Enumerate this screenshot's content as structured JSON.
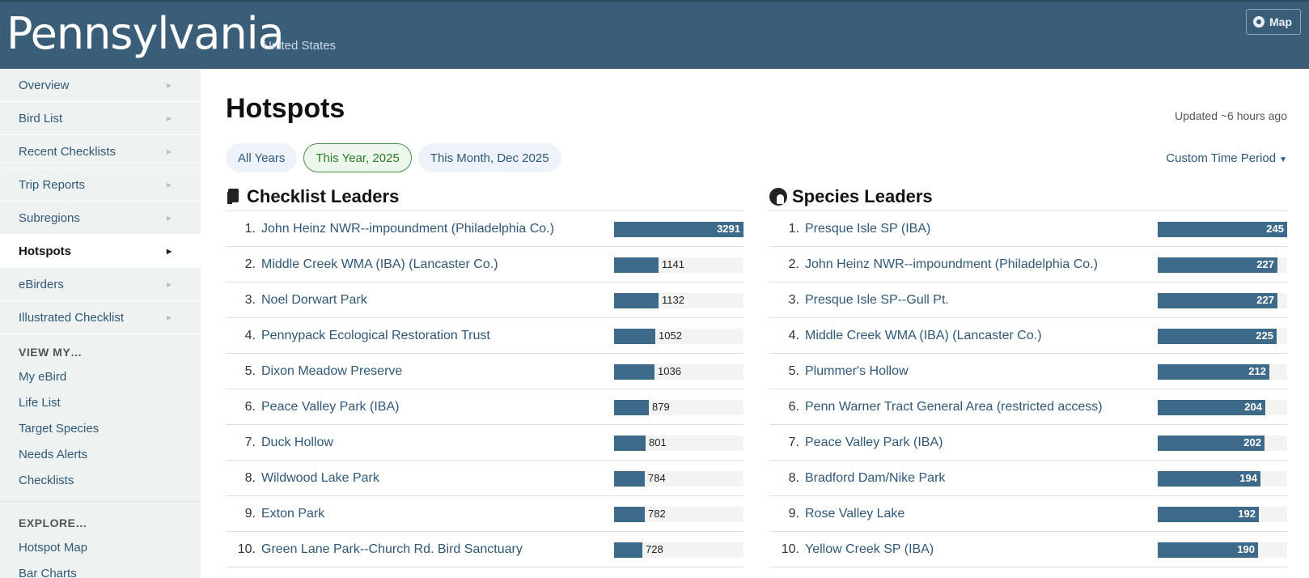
{
  "header": {
    "title": "Pennsylvania",
    "subtitle": "United States",
    "map_label": "Map"
  },
  "sidebar": {
    "items": [
      {
        "label": "Overview",
        "active": false
      },
      {
        "label": "Bird List",
        "active": false
      },
      {
        "label": "Recent Checklists",
        "active": false
      },
      {
        "label": "Trip Reports",
        "active": false
      },
      {
        "label": "Subregions",
        "active": false
      },
      {
        "label": "Hotspots",
        "active": true
      },
      {
        "label": "eBirders",
        "active": false
      },
      {
        "label": "Illustrated Checklist",
        "active": false
      }
    ],
    "view_my_title": "VIEW MY…",
    "view_my": [
      "My eBird",
      "Life List",
      "Target Species",
      "Needs Alerts",
      "Checklists"
    ],
    "explore_title": "EXPLORE…",
    "explore": [
      "Hotspot Map",
      "Bar Charts"
    ]
  },
  "main": {
    "title": "Hotspots",
    "updated": "Updated ~6 hours ago",
    "pills": [
      {
        "label": "All Years",
        "selected": false
      },
      {
        "label": "This Year, 2025",
        "selected": true
      },
      {
        "label": "This Month, Dec 2025",
        "selected": false
      }
    ],
    "custom_period": "Custom Time Period"
  },
  "checklist_leaders": {
    "title": "Checklist Leaders",
    "max": 3291,
    "rows": [
      {
        "rank": "1.",
        "name": "John Heinz NWR--impoundment (Philadelphia Co.)",
        "value": 3291
      },
      {
        "rank": "2.",
        "name": "Middle Creek WMA (IBA) (Lancaster Co.)",
        "value": 1141
      },
      {
        "rank": "3.",
        "name": "Noel Dorwart Park",
        "value": 1132
      },
      {
        "rank": "4.",
        "name": "Pennypack Ecological Restoration Trust",
        "value": 1052
      },
      {
        "rank": "5.",
        "name": "Dixon Meadow Preserve",
        "value": 1036
      },
      {
        "rank": "6.",
        "name": "Peace Valley Park (IBA)",
        "value": 879
      },
      {
        "rank": "7.",
        "name": "Duck Hollow",
        "value": 801
      },
      {
        "rank": "8.",
        "name": "Wildwood Lake Park",
        "value": 784
      },
      {
        "rank": "9.",
        "name": "Exton Park",
        "value": 782
      },
      {
        "rank": "10.",
        "name": "Green Lane Park--Church Rd. Bird Sanctuary",
        "value": 728
      }
    ]
  },
  "species_leaders": {
    "title": "Species Leaders",
    "max": 245,
    "rows": [
      {
        "rank": "1.",
        "name": "Presque Isle SP (IBA)",
        "value": 245
      },
      {
        "rank": "2.",
        "name": "John Heinz NWR--impoundment (Philadelphia Co.)",
        "value": 227
      },
      {
        "rank": "3.",
        "name": "Presque Isle SP--Gull Pt.",
        "value": 227
      },
      {
        "rank": "4.",
        "name": "Middle Creek WMA (IBA) (Lancaster Co.)",
        "value": 225
      },
      {
        "rank": "5.",
        "name": "Plummer's Hollow",
        "value": 212
      },
      {
        "rank": "6.",
        "name": "Penn Warner Tract General Area (restricted access)",
        "value": 204
      },
      {
        "rank": "7.",
        "name": "Peace Valley Park (IBA)",
        "value": 202
      },
      {
        "rank": "8.",
        "name": "Bradford Dam/Nike Park",
        "value": 194
      },
      {
        "rank": "9.",
        "name": "Rose Valley Lake",
        "value": 192
      },
      {
        "rank": "10.",
        "name": "Yellow Creek SP (IBA)",
        "value": 190
      }
    ]
  },
  "colors": {
    "header_bg": "#3a5d78",
    "link": "#2f5878",
    "bar": "#3d6a8b",
    "selected_pill": "#2a7a2a"
  }
}
